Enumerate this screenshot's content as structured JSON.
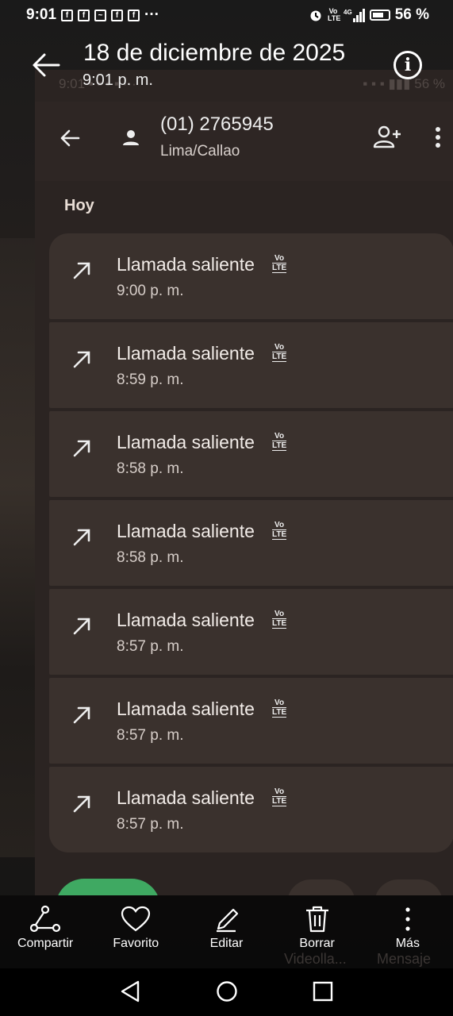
{
  "status_bar": {
    "time": "9:01",
    "notifications": [
      "facebook-icon",
      "facebook-icon",
      "messenger-icon",
      "facebook-icon",
      "facebook-icon"
    ],
    "more": "···",
    "battery": "56 %",
    "volte": "Vo LTE",
    "network": "4G"
  },
  "viewer": {
    "title": "18 de diciembre de 2025",
    "subtitle": "9:01 p. m.",
    "info_icon": "info-icon",
    "back_icon": "back-arrow-icon"
  },
  "contact": {
    "number": "(01) 2765945",
    "region": "Lima/Callao",
    "section": "Hoy"
  },
  "calls": [
    {
      "type": "Llamada saliente",
      "badge": "Vo LTE",
      "time": "9:00 p. m."
    },
    {
      "type": "Llamada saliente",
      "badge": "Vo LTE",
      "time": "8:59 p. m."
    },
    {
      "type": "Llamada saliente",
      "badge": "Vo LTE",
      "time": "8:58 p. m."
    },
    {
      "type": "Llamada saliente",
      "badge": "Vo LTE",
      "time": "8:58 p. m."
    },
    {
      "type": "Llamada saliente",
      "badge": "Vo LTE",
      "time": "8:57 p. m."
    },
    {
      "type": "Llamada saliente",
      "badge": "Vo LTE",
      "time": "8:57 p. m."
    },
    {
      "type": "Llamada saliente",
      "badge": "Vo LTE",
      "time": "8:57 p. m."
    }
  ],
  "inner_bottom": {
    "video_label": "Videolla...",
    "message_label": "Mensaje"
  },
  "actions": [
    {
      "label": "Compartir",
      "icon": "share-icon"
    },
    {
      "label": "Favorito",
      "icon": "heart-icon"
    },
    {
      "label": "Editar",
      "icon": "pencil-icon"
    },
    {
      "label": "Borrar",
      "icon": "trash-icon"
    },
    {
      "label": "Más",
      "icon": "more-vertical-icon"
    }
  ],
  "colors": {
    "panel": "#2b2422",
    "card": "#3a312d",
    "call_button": "#3fa962"
  }
}
